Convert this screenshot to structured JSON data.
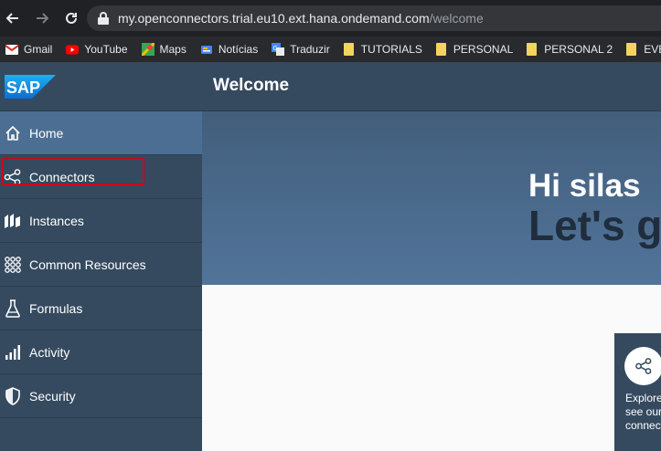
{
  "browser": {
    "url_host": "my.openconnectors.trial.eu10.ext.hana.ondemand.com",
    "url_path": "/welcome",
    "bookmarks": [
      {
        "label": "Gmail",
        "icon": "gmail-icon"
      },
      {
        "label": "YouTube",
        "icon": "youtube-icon"
      },
      {
        "label": "Maps",
        "icon": "maps-icon"
      },
      {
        "label": "Notícias",
        "icon": "news-icon"
      },
      {
        "label": "Traduzir",
        "icon": "translate-icon"
      },
      {
        "label": "TUTORIALS",
        "icon": "folder-icon"
      },
      {
        "label": "PERSONAL",
        "icon": "folder-icon"
      },
      {
        "label": "PERSONAL 2",
        "icon": "folder-icon"
      },
      {
        "label": "EVERIS",
        "icon": "folder-icon"
      }
    ]
  },
  "header": {
    "logo": "SAP",
    "title": "Welcome"
  },
  "sidebar": {
    "items": [
      {
        "label": "Home",
        "icon": "home-icon"
      },
      {
        "label": "Connectors",
        "icon": "connectors-share-icon"
      },
      {
        "label": "Instances",
        "icon": "instances-icon"
      },
      {
        "label": "Common Resources",
        "icon": "common-resources-icon"
      },
      {
        "label": "Formulas",
        "icon": "flask-icon"
      },
      {
        "label": "Activity",
        "icon": "bar-chart-icon"
      },
      {
        "label": "Security",
        "icon": "shield-icon"
      }
    ]
  },
  "hero": {
    "greeting": "Hi silas",
    "subtitle": "Let's g"
  },
  "card": {
    "text": "Explore\nsee our\nconnec"
  },
  "colors": {
    "shell": "#354a5f",
    "active_item": "#4c6e93",
    "highlight": "#d0021b"
  }
}
